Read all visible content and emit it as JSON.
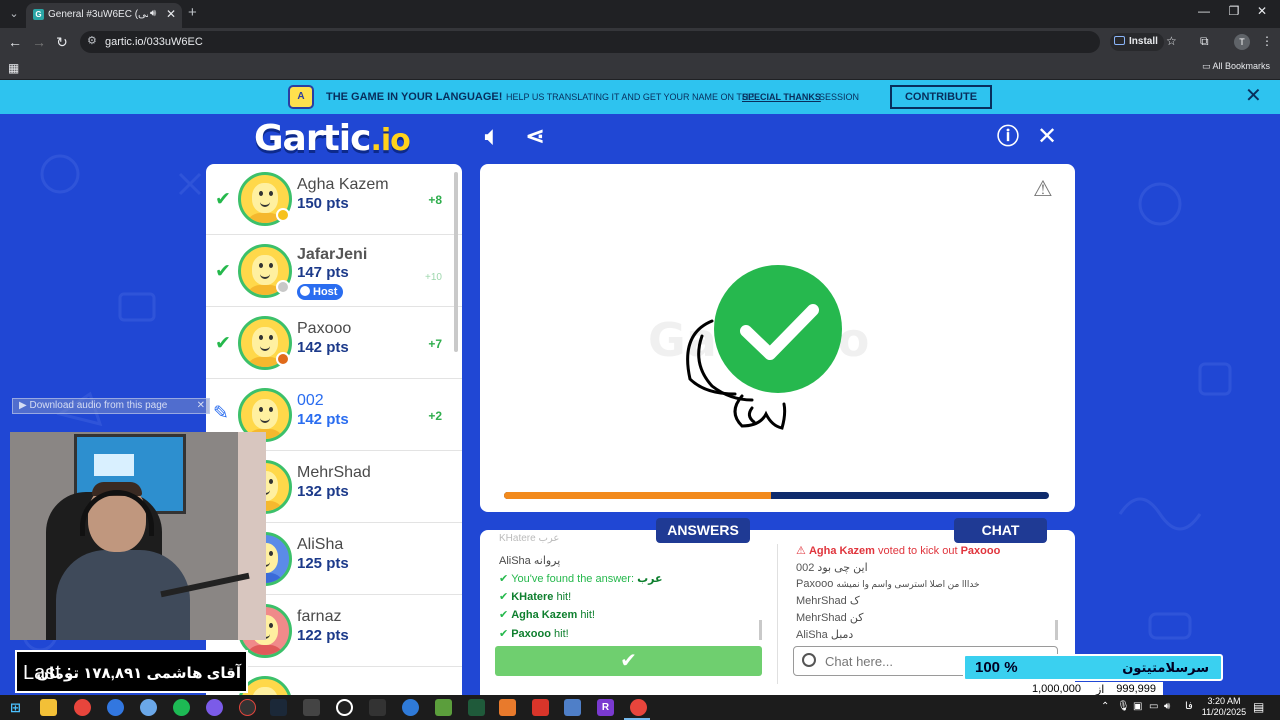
{
  "browser": {
    "tab_title": "General #3uW6EC (فارسی) - ...",
    "url": "gartic.io/033uW6EC",
    "install_label": "Install",
    "all_bookmarks": "All Bookmarks"
  },
  "banner": {
    "headline": "THE GAME IN YOUR LANGUAGE!",
    "help_text": "HELP US TRANSLATING IT AND GET YOUR NAME ON THE",
    "link_text": "SPECIAL THANKS",
    "session_text": "SESSION",
    "contribute_label": "CONTRIBUTE"
  },
  "game": {
    "logo_main": "Gartic",
    "logo_suffix": ".io",
    "players": [
      {
        "name": "Agha Kazem",
        "pts": "150 pts",
        "delta": "+8",
        "status": "found",
        "dot": "#f6c21c"
      },
      {
        "name": "JafarJeni",
        "pts": "147 pts",
        "delta": "+10",
        "status": "found",
        "dot": "#c8c8c8",
        "host": "Host"
      },
      {
        "name": "Paxooo",
        "pts": "142 pts",
        "delta": "+7",
        "status": "found",
        "dot": "#e06a1a"
      },
      {
        "name": "002",
        "pts": "142 pts",
        "delta": "+2",
        "status": "drawing"
      },
      {
        "name": "MehrShad",
        "pts": "132 pts",
        "delta": "",
        "status": "none"
      },
      {
        "name": "AliSha",
        "pts": "125 pts",
        "delta": "",
        "status": "none"
      },
      {
        "name": "farnaz",
        "pts": "122 pts",
        "delta": "",
        "status": "none"
      }
    ],
    "round_progress": 0.49,
    "answers_label": "ANSWERS",
    "chat_label": "CHAT",
    "answers": {
      "faded_top": "KHatere عرب",
      "line1_name": "AliSha",
      "line1_text": "پروانه",
      "found_text": "You've found the answer:",
      "found_word": "عرب",
      "hits": [
        {
          "name": "KHatere",
          "text": "hit!"
        },
        {
          "name": "Agha Kazem",
          "text": "hit!"
        },
        {
          "name": "Paxooo",
          "text": "hit!"
        }
      ]
    },
    "chat": {
      "kick_actor": "Agha Kazem",
      "kick_text": "voted to kick out",
      "kick_target": "Paxooo",
      "messages": [
        {
          "name": "002",
          "text": "این چی بود"
        },
        {
          "name": "Paxooo",
          "text": "خدااا من اصلا استرسی واسم وا نمیشه"
        },
        {
          "name": "MehrShad",
          "text": "ک"
        },
        {
          "name": "MehrShad",
          "text": "کن"
        },
        {
          "name": "AliSha",
          "text": "دمبل"
        }
      ],
      "placeholder": "Chat here..."
    }
  },
  "overlays": {
    "download_audio": "Download audio from this page",
    "donation_last": "Last :",
    "donation_text": "آقای هاشمی ۱۷۸,۸۹۱ تومان",
    "goal_percent": "100 %",
    "goal_title": "سرسلامتیتون",
    "goal_target": "1,000,000",
    "goal_of": "از",
    "goal_current": "999,999"
  },
  "taskbar": {
    "lang": "فا",
    "time": "3:20 AM",
    "date": "11/20/2025"
  },
  "colors": {
    "game_bg": "#2047d4",
    "banner_bg": "#2ec3ef",
    "success_green": "#25b84c",
    "progress_orange": "#f28a1c",
    "progress_navy": "#0e2a6c"
  }
}
